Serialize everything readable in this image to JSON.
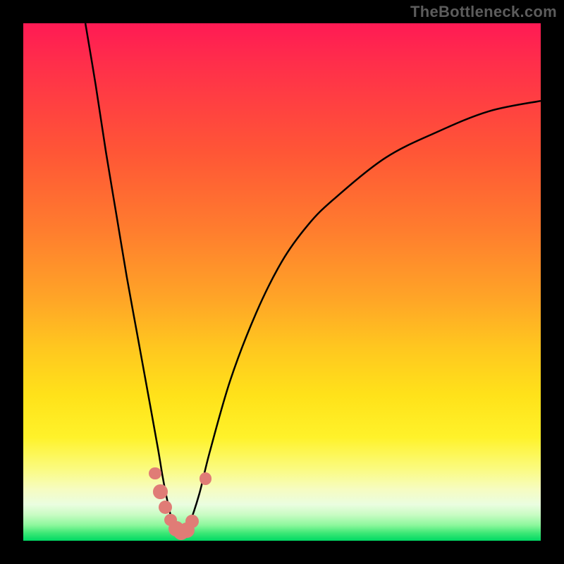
{
  "watermark": "TheBottleneck.com",
  "chart_data": {
    "type": "line",
    "title": "",
    "xlabel": "",
    "ylabel": "",
    "xlim": [
      0,
      100
    ],
    "ylim": [
      0,
      100
    ],
    "grid": false,
    "series": [
      {
        "name": "curve",
        "x": [
          12,
          14,
          16,
          18,
          20,
          22,
          24,
          26,
          27,
          28,
          29,
          30,
          31,
          32,
          34,
          36,
          40,
          45,
          50,
          55,
          60,
          70,
          80,
          90,
          100
        ],
        "values": [
          100,
          88,
          75,
          63,
          51,
          40,
          29,
          18,
          12,
          7,
          3,
          1.5,
          1.5,
          3,
          9,
          17,
          31,
          44,
          54,
          61,
          66,
          74,
          79,
          83,
          85
        ]
      }
    ],
    "markers": [
      {
        "x": 25.5,
        "y": 13,
        "r": 1.2
      },
      {
        "x": 26.5,
        "y": 9.5,
        "r": 1.4
      },
      {
        "x": 27.5,
        "y": 6.5,
        "r": 1.3
      },
      {
        "x": 28.5,
        "y": 4,
        "r": 1.2
      },
      {
        "x": 29.5,
        "y": 2.3,
        "r": 1.5
      },
      {
        "x": 30.5,
        "y": 1.6,
        "r": 1.5
      },
      {
        "x": 31.6,
        "y": 2.1,
        "r": 1.5
      },
      {
        "x": 32.6,
        "y": 3.8,
        "r": 1.3
      },
      {
        "x": 35.2,
        "y": 12,
        "r": 1.2
      }
    ],
    "background_gradient": {
      "top": "#ff1a54",
      "mid": "#ffe21a",
      "bottom": "#00d964"
    }
  }
}
